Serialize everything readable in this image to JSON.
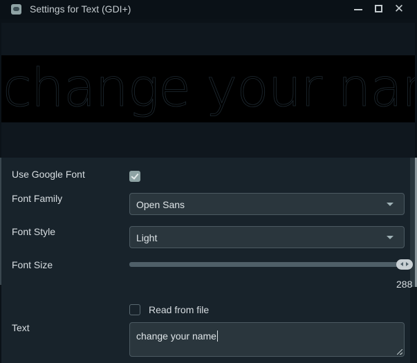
{
  "window": {
    "title": "Settings for Text (GDI+)",
    "controls": {
      "minimize": "minimize",
      "maximize": "maximize",
      "close": "✕"
    }
  },
  "preview": {
    "text": "change your name"
  },
  "properties": {
    "use_google_font": {
      "label": "Use Google Font",
      "checked": true
    },
    "font_family": {
      "label": "Font Family",
      "value": "Open Sans"
    },
    "font_style": {
      "label": "Font Style",
      "value": "Light"
    },
    "font_size": {
      "label": "Font Size",
      "value": "288",
      "slider_fraction": 1.0
    },
    "read_from_file": {
      "label": "Read from file",
      "checked": false
    },
    "text": {
      "label": "Text",
      "value": "change your name"
    }
  },
  "colors": {
    "background": "#18232b",
    "title_bar": "#0a1117",
    "input_bg": "#2a363d",
    "checkbox_checked": "#8ea3a4",
    "slider_track": "#4f5f68"
  }
}
